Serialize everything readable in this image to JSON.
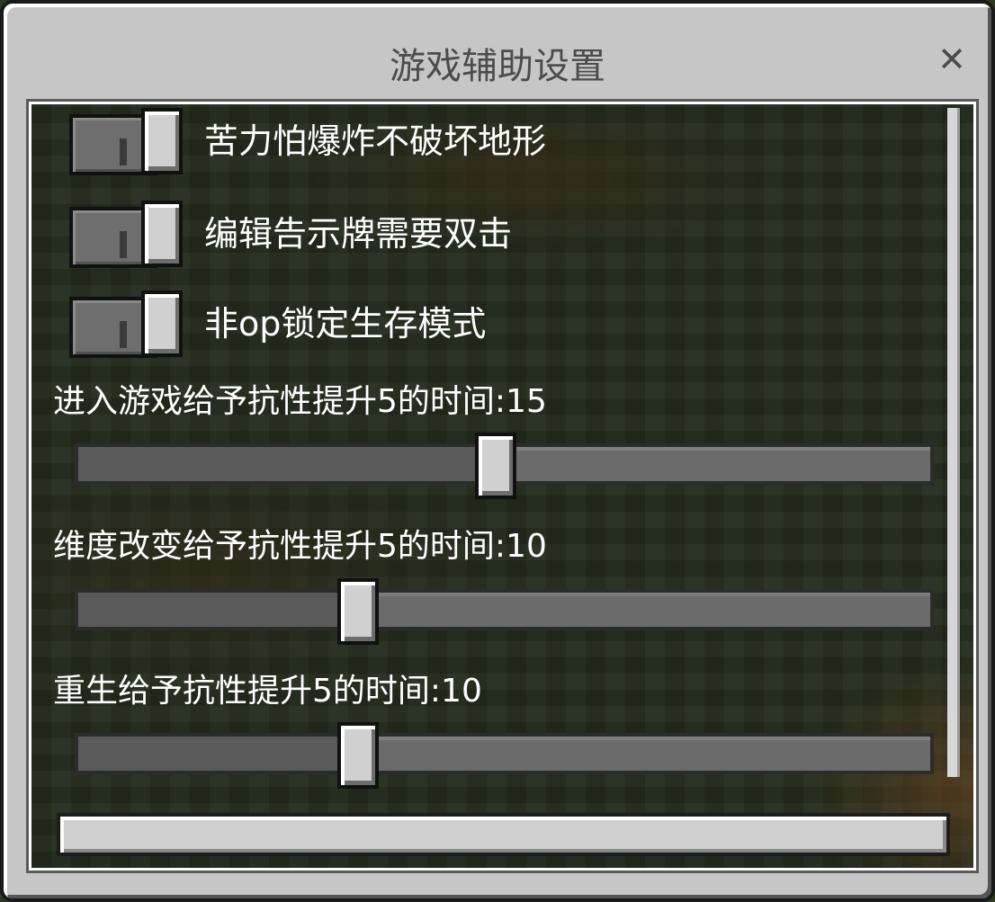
{
  "dialog": {
    "title": "游戏辅助设置",
    "close_glyph": "✕"
  },
  "toggles": [
    {
      "label": "苦力怕爆炸不破坏地形",
      "on": false
    },
    {
      "label": "编辑告示牌需要双击",
      "on": false
    },
    {
      "label": "非op锁定生存模式",
      "on": false
    }
  ],
  "sliders": [
    {
      "label": "进入游戏给予抗性提升5的时间:15",
      "value": 15,
      "fraction": 0.49
    },
    {
      "label": "维度改变给予抗性提升5的时间:10",
      "value": 10,
      "fraction": 0.33
    },
    {
      "label": "重生给予抗性提升5的时间:10",
      "value": 10,
      "fraction": 0.33
    }
  ],
  "bottom_button": {
    "label": ""
  },
  "colors": {
    "panel": "#c6c6c6",
    "knob": "#d0d0d0",
    "text": "#ffffff",
    "title": "#4c4c4c"
  }
}
